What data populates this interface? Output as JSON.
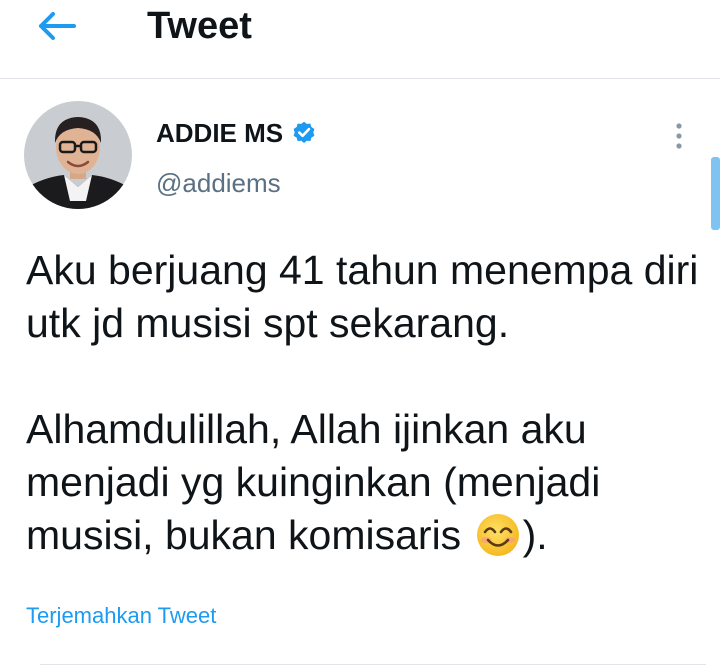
{
  "header": {
    "title": "Tweet",
    "back_icon": "arrow-left-icon"
  },
  "tweet": {
    "author": {
      "display_name": "ADDIE MS",
      "handle": "@addiems",
      "verified": true,
      "avatar": "profile-photo"
    },
    "text_lines": [
      "Aku berjuang 41 tahun menempa diri utk jd musisi spt sekarang.",
      "Alhamdulillah, Allah ijinkan aku menjadi yg kuinginkan (menjadi musisi, bukan komisaris",
      ")."
    ],
    "emoji": "smiling-face-with-smiling-eyes",
    "translate_label": "Terjemahkan Tweet",
    "more_icon": "more-vertical-icon"
  },
  "colors": {
    "accent": "#1d9bf0",
    "text_primary": "#0f1419",
    "text_secondary": "#5b7083",
    "divider": "#e1e5e9",
    "scrollbar": "#7fc3f2"
  }
}
